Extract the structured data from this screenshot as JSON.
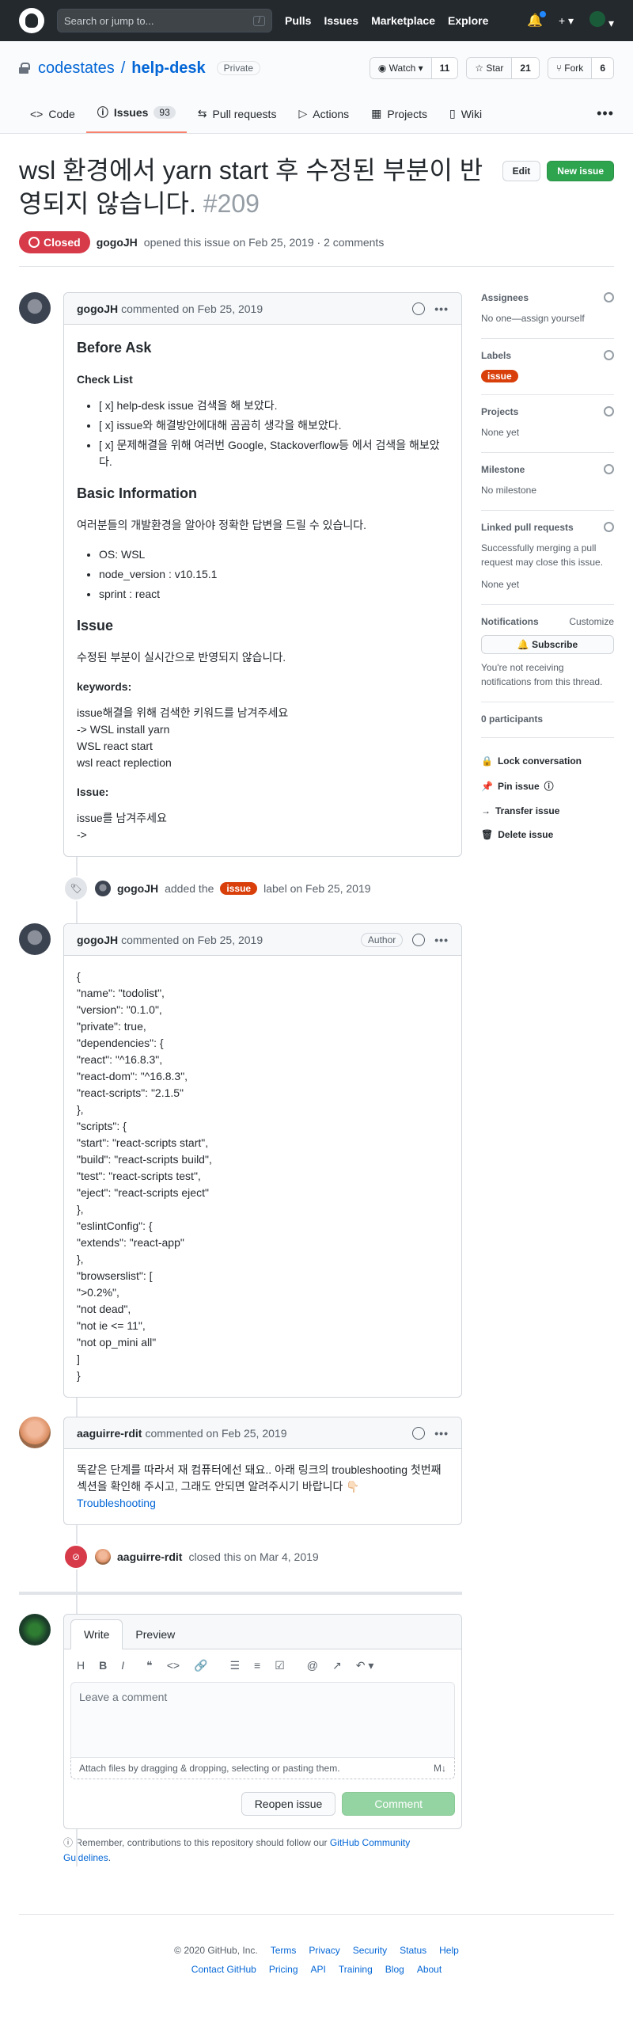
{
  "header": {
    "search_placeholder": "Search or jump to...",
    "search_key": "/",
    "nav": [
      "Pulls",
      "Issues",
      "Marketplace",
      "Explore"
    ],
    "plus": "+ ▾"
  },
  "repo": {
    "owner": "codestates",
    "sep": "/",
    "name": "help-desk",
    "visibility": "Private",
    "watch": {
      "label": "◉ Watch ▾",
      "count": "11"
    },
    "star": {
      "label": "☆ Star",
      "count": "21"
    },
    "fork": {
      "label": "⑂ Fork",
      "count": "6"
    }
  },
  "tabs": [
    {
      "icon": "<>",
      "label": "Code"
    },
    {
      "icon": "ⓘ",
      "label": "Issues",
      "count": "93"
    },
    {
      "icon": "⇆",
      "label": "Pull requests"
    },
    {
      "icon": "▷",
      "label": "Actions"
    },
    {
      "icon": "▦",
      "label": "Projects"
    },
    {
      "icon": "▯",
      "label": "Wiki"
    }
  ],
  "more": "•••",
  "issue": {
    "title": "wsl 환경에서 yarn start 후 수정된 부분이 반영되지 않습니다.",
    "number": "#209",
    "edit": "Edit",
    "new": "New issue",
    "state": "Closed",
    "author": "gogoJH",
    "opened": "opened this issue on Feb 25, 2019 · 2 comments"
  },
  "c1": {
    "user": "gogoJH",
    "when": "commented on Feb 25, 2019",
    "h_before": "Before Ask",
    "h_check": "Check List",
    "checks": [
      "[ x] help-desk issue 검색을 해 보았다.",
      "[ x] issue와 해결방안에대해 곰곰히 생각을 해보았다.",
      "[ x] 문제해결을 위해 여러번 Google, Stackoverflow등 에서 검색을 해보았다."
    ],
    "h_basic": "Basic Information",
    "basic_p": "여러분들의 개발환경을 알아야 정확한 답변을 드릴 수 있습니다.",
    "env": [
      "OS: WSL",
      "node_version : v10.15.1",
      "sprint : react"
    ],
    "h_issue": "Issue",
    "issue_p": "수정된 부분이 실시간으로 반영되지 않습니다.",
    "h_kw": "keywords:",
    "kw": [
      "issue해결을 위해 검색한 키워드를 남겨주세요",
      "-> WSL install yarn",
      "WSL react start",
      "wsl react replection"
    ],
    "h_issue2": "Issue:",
    "issue2": [
      "issue를 남겨주세요",
      "->"
    ]
  },
  "e1": {
    "user": "gogoJH",
    "pre": "added the",
    "label": "issue",
    "post": "label on Feb 25, 2019"
  },
  "c2": {
    "user": "gogoJH",
    "when": "commented on Feb 25, 2019",
    "badge": "Author",
    "lines": [
      "{",
      "\"name\": \"todolist\",",
      "\"version\": \"0.1.0\",",
      "\"private\": true,",
      "\"dependencies\": {",
      "\"react\": \"^16.8.3\",",
      "\"react-dom\": \"^16.8.3\",",
      "\"react-scripts\": \"2.1.5\"",
      "},",
      "\"scripts\": {",
      "\"start\": \"react-scripts start\",",
      "\"build\": \"react-scripts build\",",
      "\"test\": \"react-scripts test\",",
      "\"eject\": \"react-scripts eject\"",
      "},",
      "\"eslintConfig\": {",
      "\"extends\": \"react-app\"",
      "},",
      "\"browserslist\": [",
      "\">0.2%\",",
      "\"not dead\",",
      "\"not ie <= 11\",",
      "\"not op_mini all\"",
      "]",
      "}"
    ]
  },
  "c3": {
    "user": "aaguirre-rdit",
    "when": "commented on Feb 25, 2019",
    "text": "똑같은 단계를 따라서 재 컴퓨터에선 돼요.. 아래 링크의 troubleshooting 첫번째 섹션을 확인해 주시고, 그래도 안되면 알려주시기 바랍니다 👇🏻",
    "link": "Troubleshooting"
  },
  "e2": {
    "user": "aaguirre-rdit",
    "text": "closed this on Mar 4, 2019"
  },
  "editor": {
    "write": "Write",
    "preview": "Preview",
    "placeholder": "Leave a comment",
    "attach": "Attach files by dragging & dropping, selecting or pasting them.",
    "md": "M↓",
    "reopen": "Reopen issue",
    "comment": "Comment",
    "guide": "Remember, contributions to this repository should follow our",
    "guide_link": "GitHub Community Guidelines",
    "guide_end": "."
  },
  "sidebar": {
    "assignees": "Assignees",
    "assignees_v": "No one—assign yourself",
    "labels": "Labels",
    "label_v": "issue",
    "projects": "Projects",
    "projects_v": "None yet",
    "milestone": "Milestone",
    "milestone_v": "No milestone",
    "linked": "Linked pull requests",
    "linked_desc": "Successfully merging a pull request may close this issue.",
    "linked_v": "None yet",
    "notif": "Notifications",
    "customize": "Customize",
    "subscribe": "Subscribe",
    "notif_desc": "You're not receiving notifications from this thread.",
    "participants": "0 participants",
    "lock": "Lock conversation",
    "pin": "Pin issue",
    "transfer": "Transfer issue",
    "delete": "Delete issue"
  },
  "footer": {
    "copy": "© 2020 GitHub, Inc.",
    "row1": [
      "Terms",
      "Privacy",
      "Security",
      "Status",
      "Help"
    ],
    "row2": [
      "Contact GitHub",
      "Pricing",
      "API",
      "Training",
      "Blog",
      "About"
    ]
  }
}
